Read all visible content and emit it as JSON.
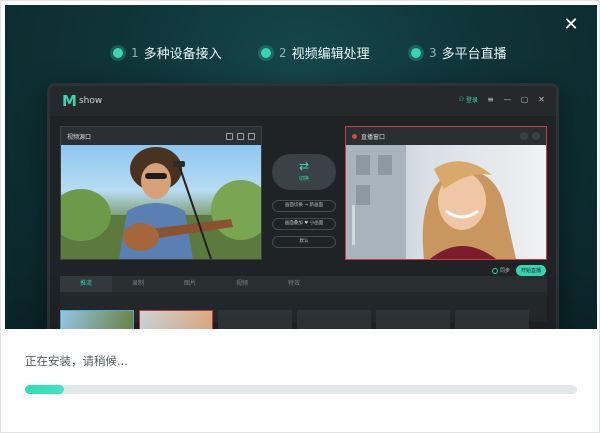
{
  "close_icon": "close-icon",
  "steps": [
    {
      "num": "1",
      "label": "多种设备接入"
    },
    {
      "num": "2",
      "label": "视频编辑处理"
    },
    {
      "num": "3",
      "label": "多平台直播"
    }
  ],
  "app_preview": {
    "brand": "show",
    "login_label": "登录",
    "left_panel_title": "视频源口",
    "right_panel_title": "直播窗口",
    "switch_label": "切换",
    "option_a": "画面切换 → 新画面",
    "option_b": "画面叠加 ♥ 小画面",
    "option_c": "默认",
    "radio_label": "同步",
    "go_live_label": "开始直播",
    "tabs": [
      "推流",
      "录制",
      "图片",
      "视频",
      "特效"
    ]
  },
  "status_text": "正在安装，请稍候...",
  "progress": {
    "value": 0.07,
    "color": "#2fdcb4"
  }
}
